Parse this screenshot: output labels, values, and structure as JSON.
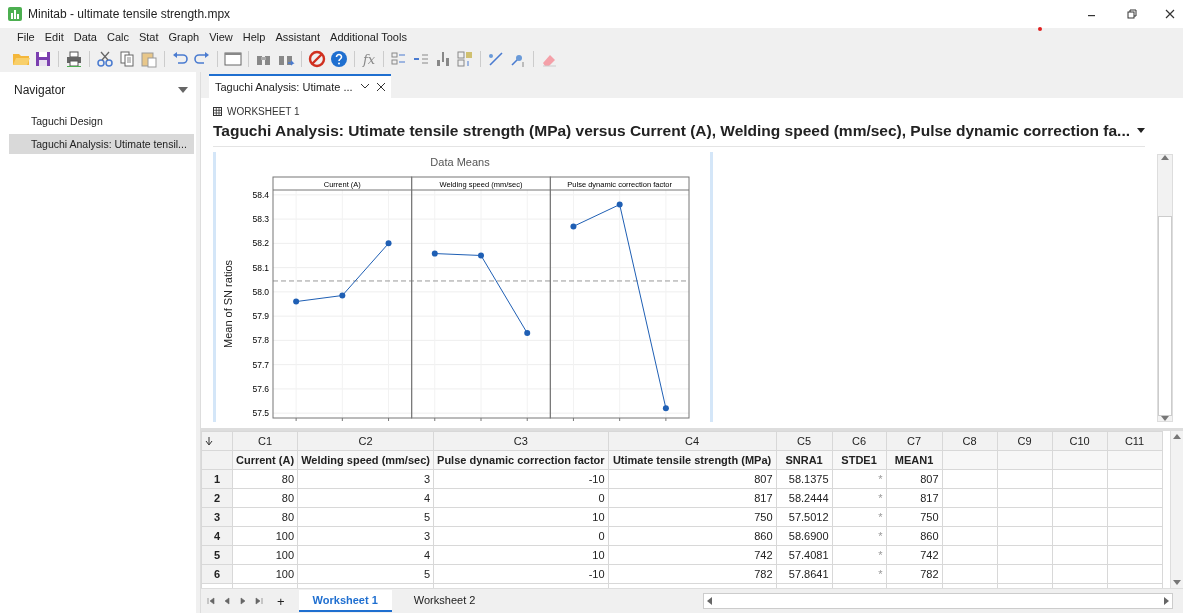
{
  "window": {
    "title": "Minitab - ultimate tensile strength.mpx"
  },
  "menu": [
    "File",
    "Edit",
    "Data",
    "Calc",
    "Stat",
    "Graph",
    "View",
    "Help",
    "Assistant",
    "Additional Tools"
  ],
  "toolbar": {
    "formula_label": "fx"
  },
  "navigator": {
    "title": "Navigator",
    "items": [
      {
        "label": "Taguchi Design",
        "selected": false
      },
      {
        "label": "Taguchi Analysis: Utimate tensil...",
        "selected": true
      }
    ]
  },
  "output_tabs": [
    {
      "label": "Taguchi Analysis: Utimate ...",
      "selected": true
    }
  ],
  "output": {
    "worksheet": "WORKSHEET 1",
    "title": "Taguchi Analysis: Utimate tensile strength (MPa) versus Current (A), Welding speed (mm/sec), Pulse dynamic correction fa...",
    "chart_data": {
      "type": "line",
      "title": "Data Means",
      "ylabel": "Mean of SN ratios",
      "grid": true,
      "ylim": [
        57.48,
        58.42
      ],
      "yticks": [
        57.5,
        57.6,
        57.7,
        57.8,
        57.9,
        {
          "value": 58.0,
          "label": "58.0"
        },
        58.1,
        58.2,
        58.3,
        58.4
      ],
      "series": [
        {
          "color": "#1f5fb4",
          "marker": "o",
          "values": [
            57.96,
            57.985,
            58.2,
            null,
            null,
            null,
            null,
            null,
            null
          ]
        },
        {
          "color": "#1f5fb4",
          "marker": "o",
          "values": [
            null,
            null,
            null,
            58.158,
            58.15,
            57.83,
            null,
            null,
            null
          ]
        },
        {
          "color": "#1f5fb4",
          "marker": "o",
          "values": [
            null,
            null,
            null,
            null,
            null,
            null,
            58.27,
            58.36,
            57.52
          ]
        }
      ],
      "ref_lines": [
        {
          "axis": "y",
          "value": 58.045
        }
      ],
      "annotations": [
        {
          "text": "Current (A)"
        },
        {
          "text": "Welding speed (mm/sec)"
        },
        {
          "text": "Pulse dynamic correction factor"
        }
      ]
    }
  },
  "worksheet": {
    "columns": [
      {
        "id": "C1",
        "name": "Current (A)"
      },
      {
        "id": "C2",
        "name": "Welding speed (mm/sec)"
      },
      {
        "id": "C3",
        "name": "Pulse dynamic correction factor"
      },
      {
        "id": "C4",
        "name": "Utimate tensile strength (MPa)"
      },
      {
        "id": "C5",
        "name": "SNRA1"
      },
      {
        "id": "C6",
        "name": "STDE1"
      },
      {
        "id": "C7",
        "name": "MEAN1"
      },
      {
        "id": "C8"
      },
      {
        "id": "C9"
      },
      {
        "id": "C10"
      },
      {
        "id": "C11"
      }
    ],
    "rows": [
      {
        "number": "1",
        "cells": [
          "80",
          "3",
          "-10",
          "807",
          "58.1375",
          "*",
          "807"
        ]
      },
      {
        "number": "2",
        "cells": [
          "80",
          "4",
          "0",
          "817",
          "58.2444",
          "*",
          "817"
        ]
      },
      {
        "number": "3",
        "cells": [
          "80",
          "5",
          "10",
          "750",
          "57.5012",
          "*",
          "750"
        ]
      },
      {
        "number": "4",
        "cells": [
          "100",
          "3",
          "0",
          "860",
          "58.6900",
          "*",
          "860"
        ]
      },
      {
        "number": "5",
        "cells": [
          "100",
          "4",
          "10",
          "742",
          "57.4081",
          "*",
          "742"
        ]
      },
      {
        "number": "6",
        "cells": [
          "100",
          "5",
          "-10",
          "782",
          "57.8641",
          "*",
          "782"
        ]
      }
    ]
  },
  "sheet_tabs": {
    "add_label": "+",
    "tabs": [
      {
        "label": "Worksheet 1",
        "selected": true
      },
      {
        "label": "Worksheet 2",
        "selected": false
      }
    ]
  }
}
